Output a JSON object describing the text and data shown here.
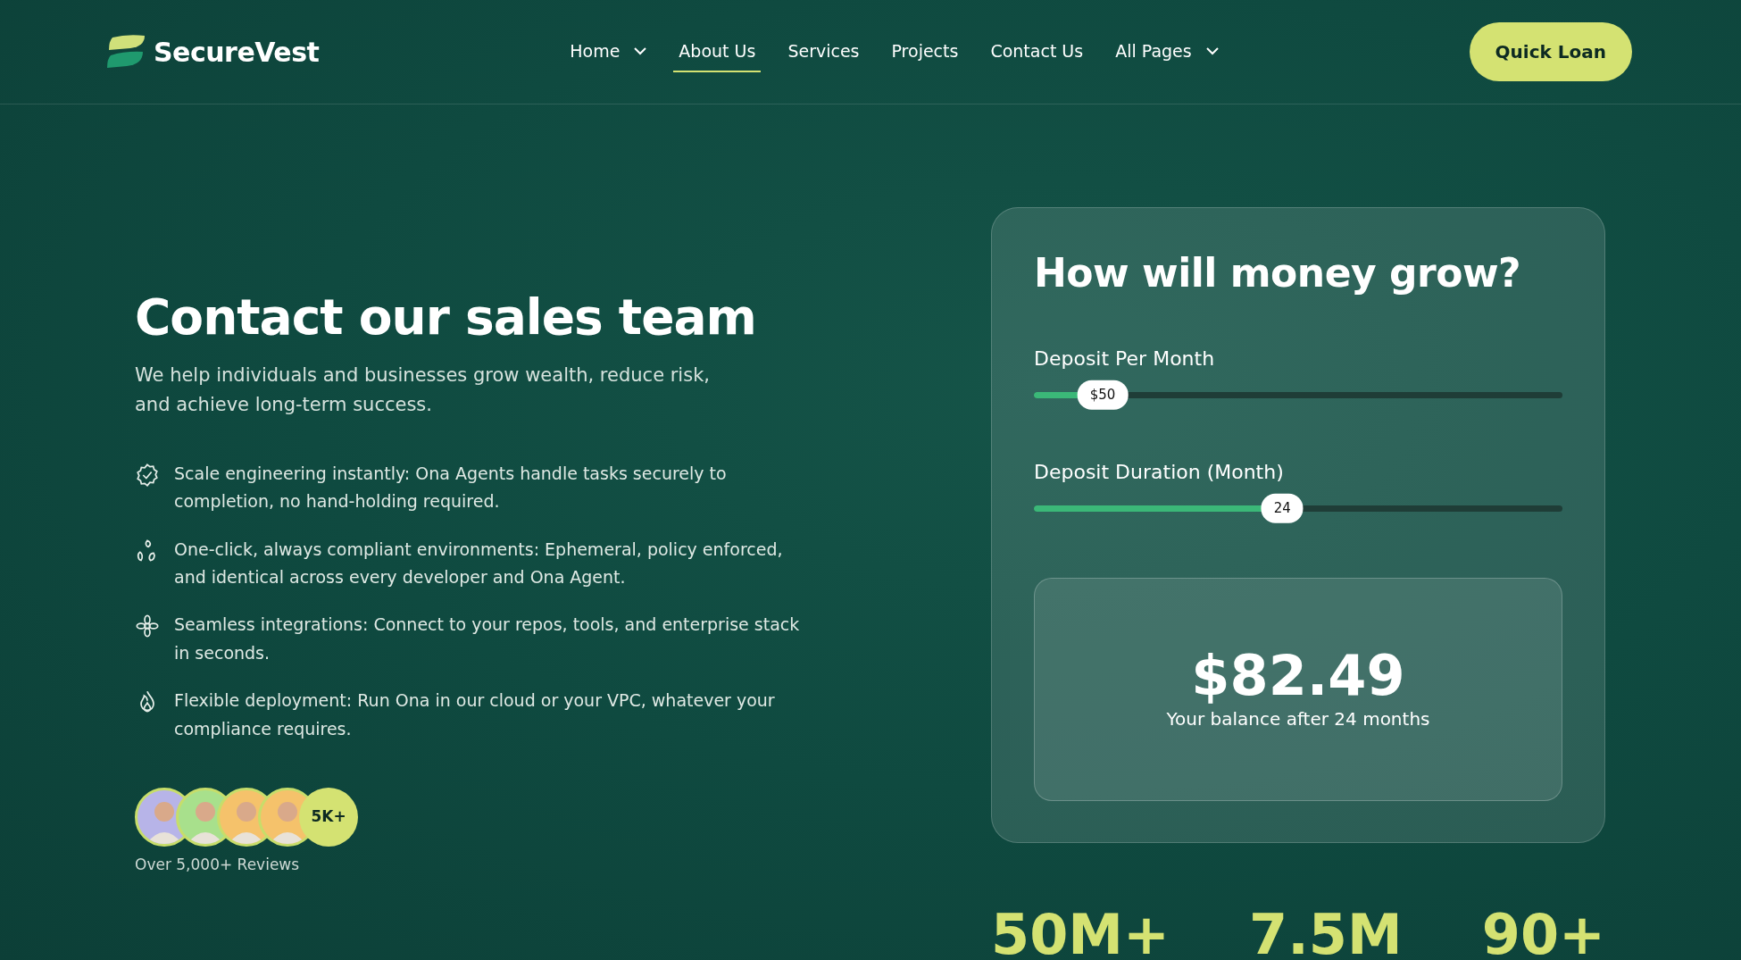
{
  "brand": {
    "name": "SecureVest"
  },
  "nav": [
    {
      "label": "Home",
      "selected": false,
      "dropdown": true
    },
    {
      "label": "About Us",
      "selected": true,
      "dropdown": false
    },
    {
      "label": "Services",
      "selected": false,
      "dropdown": false
    },
    {
      "label": "Projects",
      "selected": false,
      "dropdown": false
    },
    {
      "label": "Contact Us",
      "selected": false,
      "dropdown": false
    },
    {
      "label": "All Pages",
      "selected": false,
      "dropdown": true
    }
  ],
  "cta": "Quick Loan",
  "hero": {
    "title": "Contact our sales team",
    "subtitle": "We help individuals and businesses grow wealth, reduce risk, and achieve long-term success.",
    "features": [
      {
        "kind": "badge",
        "text": "Scale engineering instantly: Ona Agents handle tasks securely to completion, no hand-holding required."
      },
      {
        "kind": "leaves",
        "text": "One-click, always compliant environments: Ephemeral, policy enforced, and identical across every developer and Ona Agent."
      },
      {
        "kind": "flower",
        "text": "Seamless integrations: Connect to your repos, tools, and enterprise stack in seconds."
      },
      {
        "kind": "flame",
        "text": "Flexible deployment: Run Ona in our cloud or your VPC, whatever your compliance requires."
      }
    ],
    "avatars": [
      {
        "color": "#b7b4e8"
      },
      {
        "color": "#a8e08c"
      },
      {
        "color": "#f5c26b"
      },
      {
        "color": "#f5c26b"
      }
    ],
    "avatar_count": "5K+",
    "reviews": "Over 5,000+ Reviews"
  },
  "calculator": {
    "title": "How will money grow?",
    "sliders": [
      {
        "label": "Deposit Per Month",
        "level": 0.13,
        "reading": "$50"
      },
      {
        "label": "Deposit Duration (Month)",
        "level": 0.47,
        "reading": "24"
      }
    ],
    "amount": "$82.49",
    "caption": "Your balance after 24 months"
  },
  "stats": [
    "50M+",
    "7.5M",
    "90+"
  ]
}
